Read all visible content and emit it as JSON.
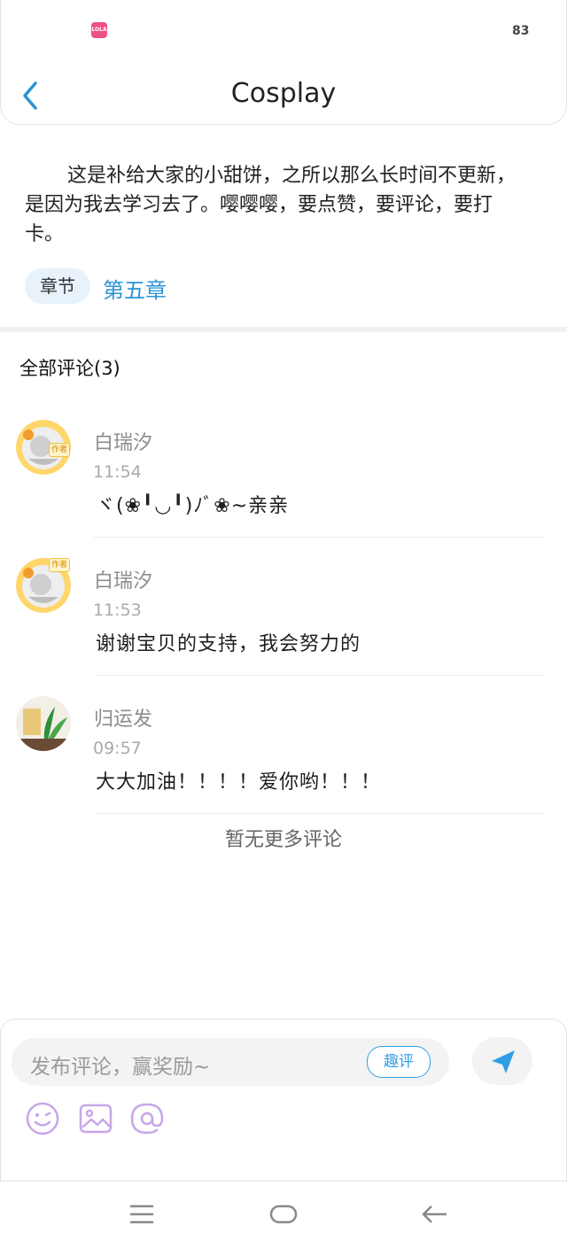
{
  "status_bar": {
    "app_badge": "LOLA",
    "battery": "83"
  },
  "header": {
    "title": "Cosplay"
  },
  "chapter": {
    "intro": "这是补给大家的小甜饼，之所以那么长时间不更新，是因为我去学习去了。嘤嘤嘤，要点赞，要评论，要打卡。",
    "tag_label": "章节",
    "link": "第五章"
  },
  "comments_section": {
    "header": "全部评论(3)",
    "items": [
      {
        "name": "白瑞汐",
        "time": "11:54",
        "text": "ヾ(❀╹◡╹)ﾉﾞ❀~亲亲",
        "avatar": "author-avatar-icon",
        "badge": "作者"
      },
      {
        "name": "白瑞汐",
        "time": "11:53",
        "text": "谢谢宝贝的支持，我会努力的",
        "avatar": "author-avatar-icon",
        "badge": "作者"
      },
      {
        "name": "归运发",
        "time": "09:57",
        "text": "大大加油！！！！爱你哟！！！",
        "avatar": "plant-avatar-icon"
      }
    ],
    "no_more": "暂无更多评论"
  },
  "composer": {
    "placeholder": "发布评论，赢奖励~",
    "quping_label": "趣评",
    "tools": [
      "emoji-icon",
      "image-icon",
      "at-icon"
    ],
    "accent": "#2f9ee6",
    "tool_color": "#c8a6e8"
  },
  "navbar": {
    "buttons": [
      "menu-icon",
      "home-icon",
      "back-arrow-icon"
    ]
  }
}
